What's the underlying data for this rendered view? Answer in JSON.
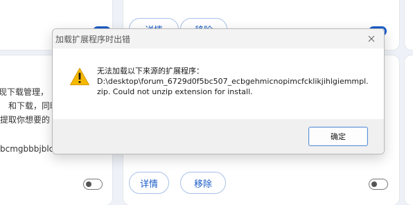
{
  "background": {
    "left_text_lines": [
      "现下载管理，",
      "和下载，同时",
      "提取你想要的"
    ],
    "left_id_fragment": "bcmgbbbjblc",
    "buttons": {
      "details": "详情",
      "remove": "移除"
    }
  },
  "dialog": {
    "title": "加载扩展程序时出错",
    "message_lines": [
      "无法加载以下来源的扩展程序：",
      "D:\\desktop\\forum_6729d0f5bc507_ecbgehmicnopimcfcklikjihlgiemmpl.",
      "zip. Could not unzip extension for install."
    ],
    "ok_label": "确定",
    "icon": "warning-icon"
  },
  "colors": {
    "accent": "#1a5cc8",
    "warning": "#f5b800"
  }
}
